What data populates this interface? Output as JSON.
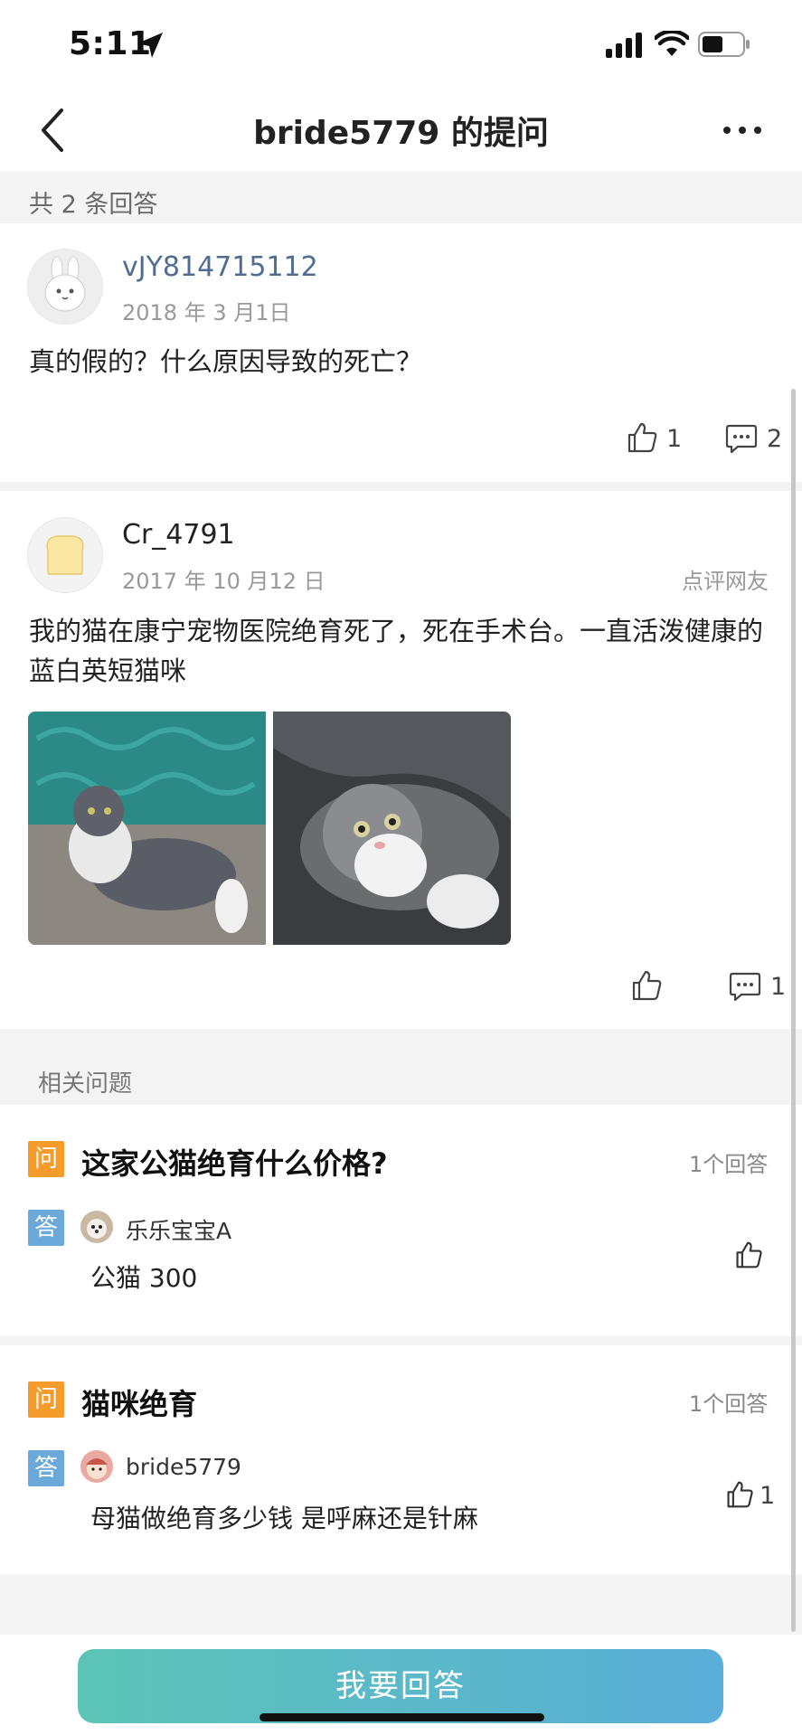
{
  "status": {
    "time": "5:11"
  },
  "nav": {
    "title": "bride5779 的提问"
  },
  "answers_count": "共 2 条回答",
  "answers": [
    {
      "username": "vJY814715112",
      "date": "2018 年 3 月1日",
      "text": "真的假的？什么原因导致的死亡？",
      "likes": "1",
      "comments": "2"
    },
    {
      "username": "Cr_4791",
      "date": "2017 年 10 月12 日",
      "source": "点评网友",
      "text": "我的猫在康宁宠物医院绝育死了，死在手术台。一直活泼健康的蓝白英短猫咪",
      "likes": "",
      "comments": "1"
    }
  ],
  "related": {
    "header": "相关问题",
    "items": [
      {
        "q_tag": "问",
        "title": "这家公猫绝育什么价格?",
        "count": "1个回答",
        "a_tag": "答",
        "user": "乐乐宝宝A",
        "answer": "公猫 300",
        "likes": ""
      },
      {
        "q_tag": "问",
        "title": "猫咪绝育",
        "count": "1个回答",
        "a_tag": "答",
        "user": "bride5779",
        "answer": "母猫做绝育多少钱 是呼麻还是针麻",
        "likes": "1"
      }
    ]
  },
  "bottom": {
    "answer_button": "我要回答"
  },
  "colors": {
    "accent_start": "#5cc4b6",
    "accent_end": "#5aaed8",
    "q_tag": "#f39c2c",
    "a_tag": "#6aa9d9",
    "link_blue": "#4f6d92"
  }
}
